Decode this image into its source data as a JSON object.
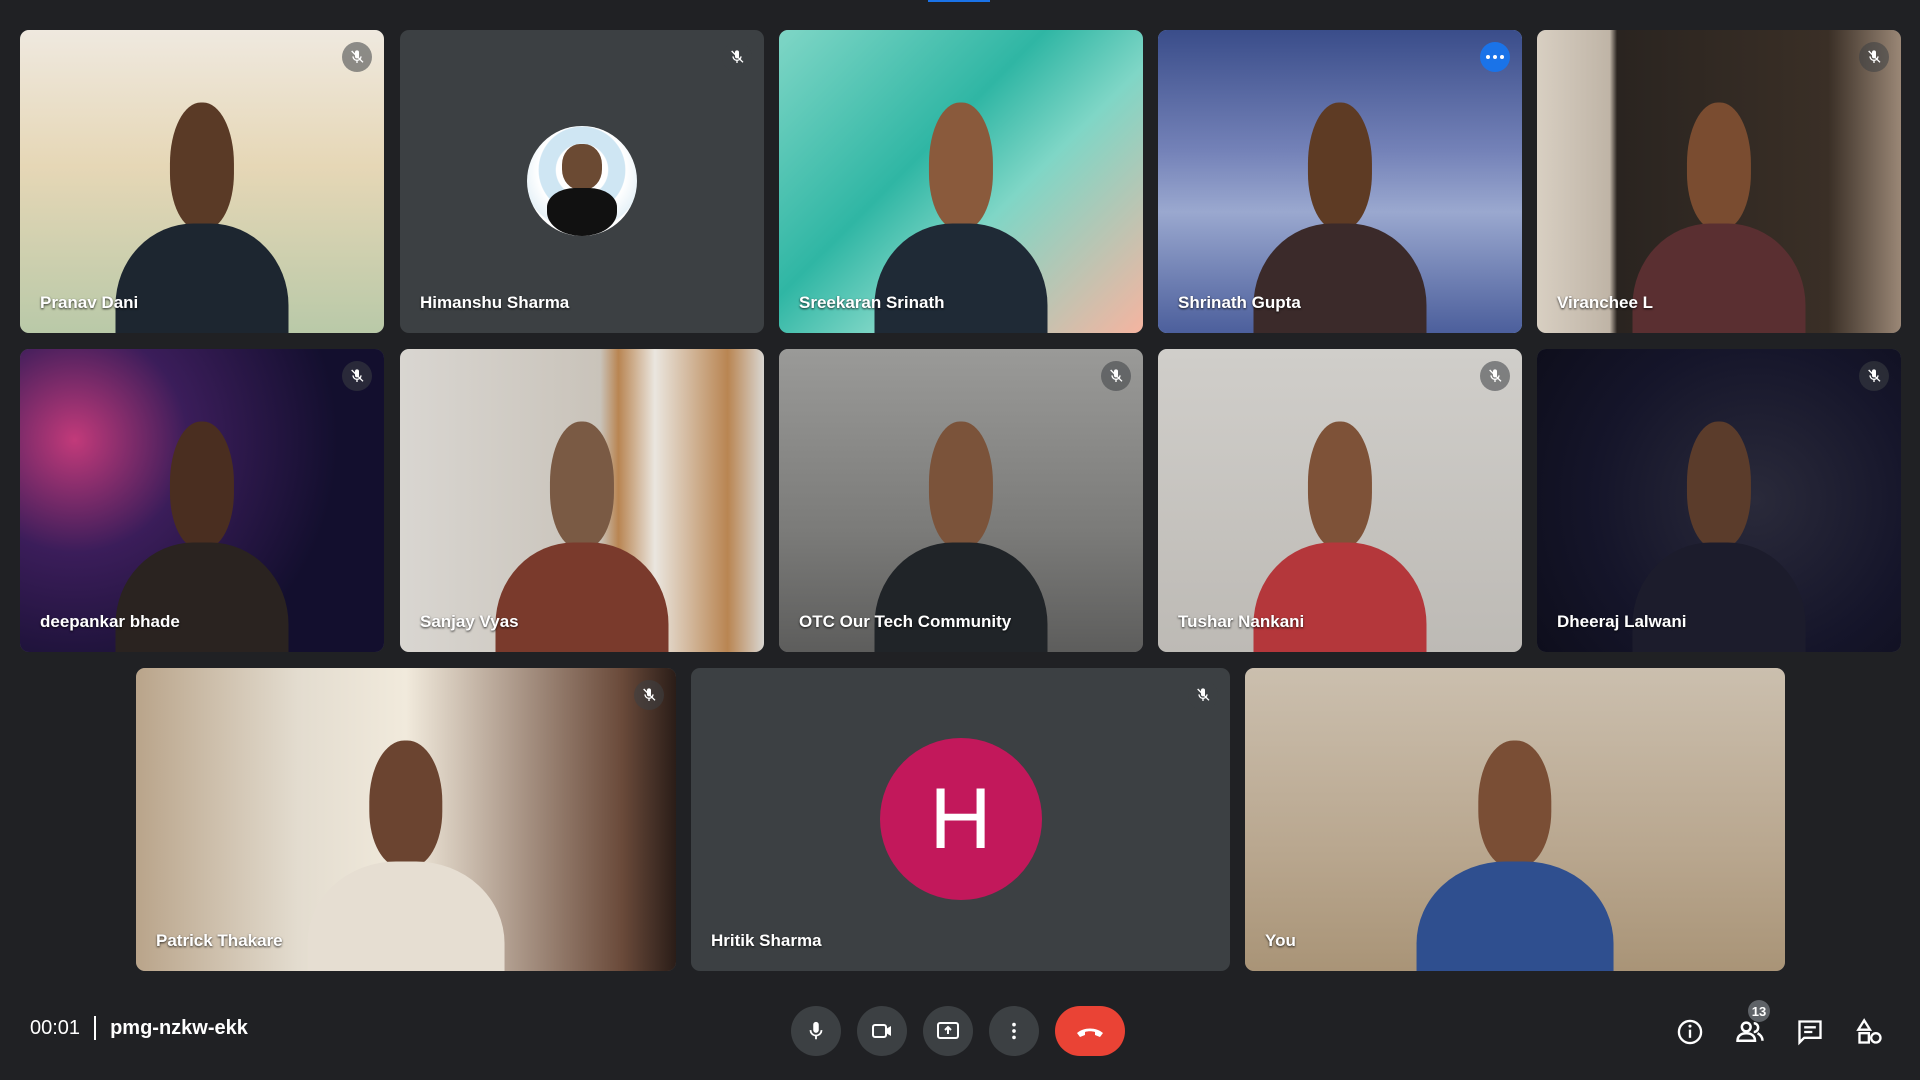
{
  "participants": [
    {
      "name": "Pranav Dani",
      "muted": true
    },
    {
      "name": "Himanshu Sharma",
      "muted": true
    },
    {
      "name": "Sreekaran Srinath",
      "muted": false
    },
    {
      "name": "Shrinath Gupta",
      "muted": false,
      "speaking": true
    },
    {
      "name": "Viranchee L",
      "muted": true
    },
    {
      "name": "deepankar bhade",
      "muted": true
    },
    {
      "name": "Sanjay Vyas",
      "muted": false
    },
    {
      "name": "OTC Our Tech Community",
      "muted": true
    },
    {
      "name": "Tushar Nankani",
      "muted": true
    },
    {
      "name": "Dheeraj Lalwani",
      "muted": true
    },
    {
      "name": "Patrick Thakare",
      "muted": true
    },
    {
      "name": "Hritik Sharma",
      "muted": true,
      "avatar_letter": "H",
      "avatar_color": "#c2185b"
    },
    {
      "name": "You",
      "muted": false
    }
  ],
  "meeting": {
    "time": "00:01",
    "code": "pmg-nzkw-ekk"
  },
  "controls": {
    "mic_icon": "mic-icon",
    "camera_icon": "videocam-icon",
    "present_icon": "present-screen-icon",
    "more_icon": "more-vert-icon",
    "end_icon": "call-end-icon"
  },
  "right_panel": {
    "participants_count": "13"
  },
  "colors": {
    "background": "#202124",
    "tile": "#3c4043",
    "end_call": "#ea4335",
    "accent": "#1a73e8"
  }
}
